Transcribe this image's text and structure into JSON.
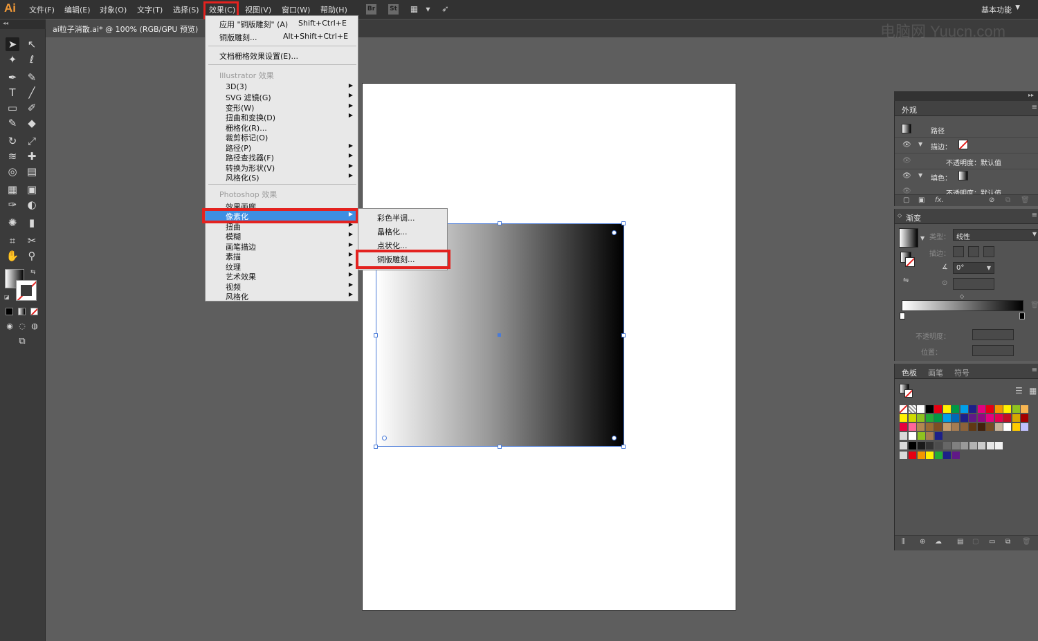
{
  "app": {
    "logo": "Ai",
    "workspace": "基本功能",
    "watermark": "电脑网 Yuucn.com"
  },
  "menubar": {
    "items": [
      "文件(F)",
      "编辑(E)",
      "对象(O)",
      "文字(T)",
      "选择(S)",
      "效果(C)",
      "视图(V)",
      "窗口(W)",
      "帮助(H)"
    ],
    "icons": [
      "Br",
      "St"
    ]
  },
  "document": {
    "tab_title": "ai粒子消散.ai* @ 100% (RGB/GPU 预览)"
  },
  "effect_menu": {
    "apply_label": "应用 \"铜版雕刻\" (A)",
    "apply_shortcut": "Shift+Ctrl+E",
    "last_label": "铜版雕刻...",
    "last_shortcut": "Alt+Shift+Ctrl+E",
    "raster_settings": "文档栅格效果设置(E)...",
    "illustrator_header": "Illustrator 效果",
    "illustrator_items": [
      "3D(3)",
      "SVG 滤镜(G)",
      "变形(W)",
      "扭曲和变换(D)",
      "栅格化(R)...",
      "裁剪标记(O)",
      "路径(P)",
      "路径查找器(F)",
      "转换为形状(V)",
      "风格化(S)"
    ],
    "photoshop_header": "Photoshop 效果",
    "photoshop_items": [
      "效果画廊...",
      "像素化",
      "扭曲",
      "模糊",
      "画笔描边",
      "素描",
      "纹理",
      "艺术效果",
      "视频",
      "风格化"
    ]
  },
  "pixelate_submenu": [
    "彩色半调...",
    "晶格化...",
    "点状化...",
    "铜版雕刻..."
  ],
  "appearance_panel": {
    "title": "外观",
    "object": "路径",
    "stroke_label": "描边：",
    "opacity_label": "不透明度：默认值",
    "fill_label": "填色：",
    "opacity_label2": "不透明度：默认值"
  },
  "gradient_panel": {
    "title": "渐变",
    "type_label": "类型：",
    "type_value": "线性",
    "stroke_label": "描边：",
    "angle_value": "0°",
    "opacity_label": "不透明度：",
    "position_label": "位置："
  },
  "swatches_panel": {
    "tabs": [
      "色板",
      "画笔",
      "符号"
    ]
  },
  "colors": {
    "accent_red": "#e3221f",
    "menu_highlight": "#3e8ee2",
    "selection_blue": "#4a7bd8"
  }
}
